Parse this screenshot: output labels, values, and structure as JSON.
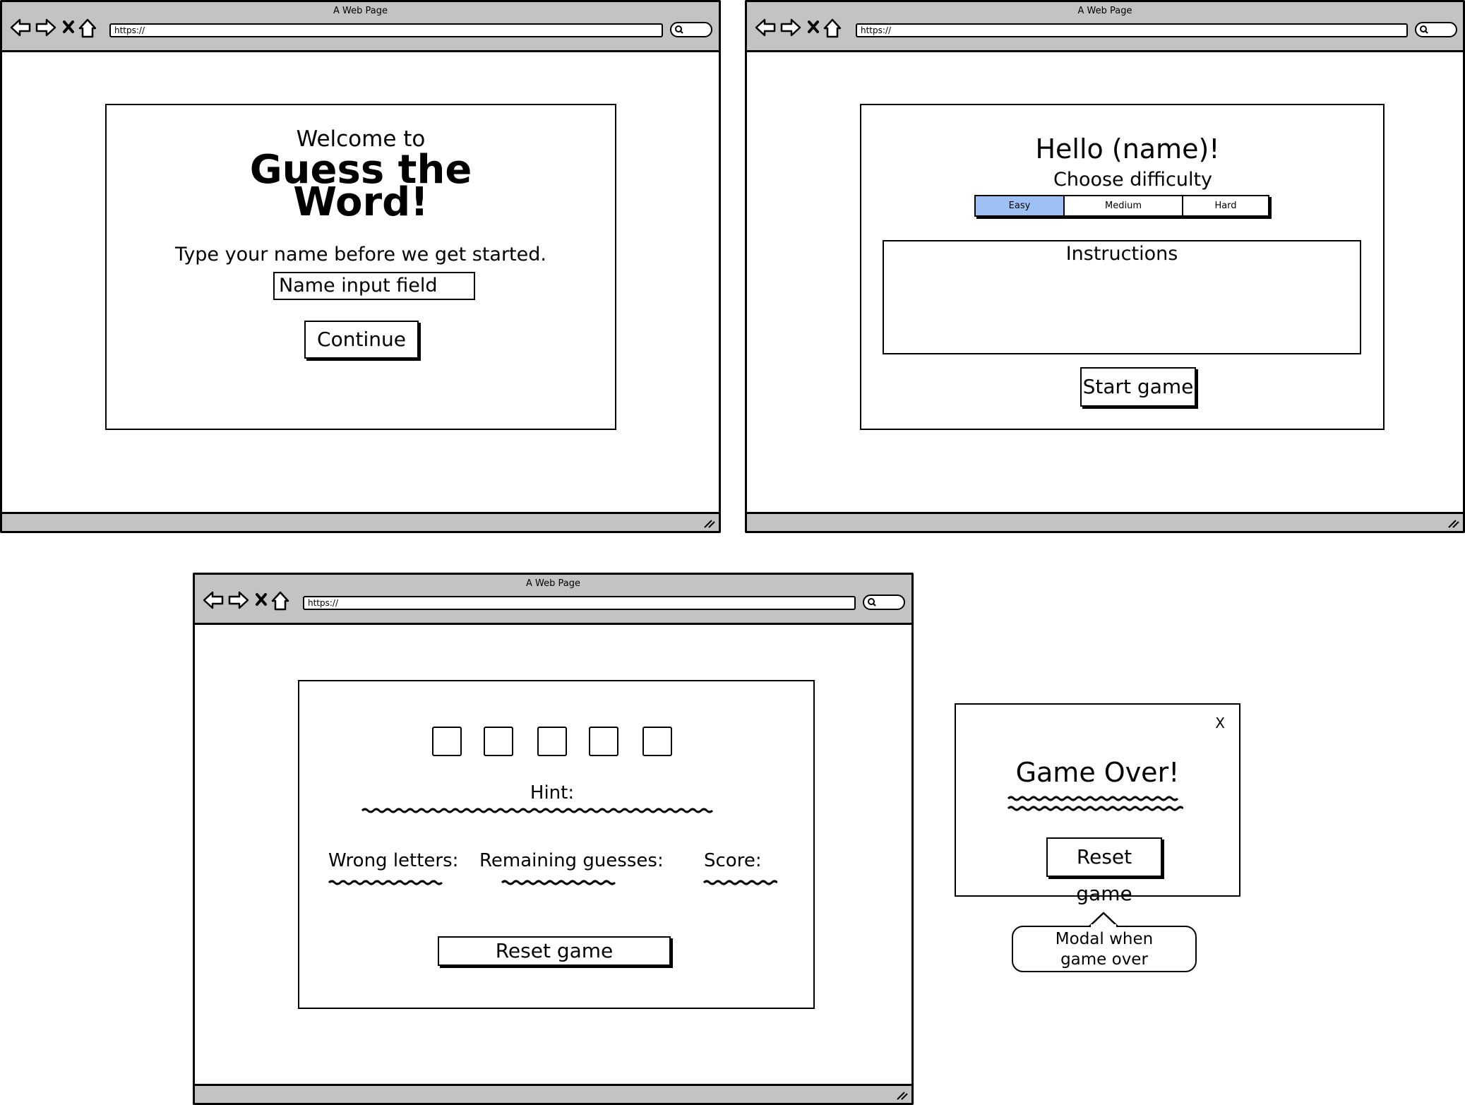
{
  "browser": {
    "window_title": "A Web Page",
    "url": "https://"
  },
  "screen1": {
    "welcome_line": "Welcome to",
    "title_line1": "Guess the",
    "title_line2": "Word!",
    "prompt": "Type your name before we get started.",
    "name_input_value": "Name input field",
    "continue_label": "Continue"
  },
  "screen2": {
    "greeting": "Hello (name)!",
    "choose_label": "Choose difficulty",
    "difficulty_options": [
      "Easy",
      "Medium",
      "Hard"
    ],
    "selected_difficulty": "Easy",
    "instructions_title": "Instructions",
    "start_label": "Start game"
  },
  "screen3": {
    "letter_boxes": 5,
    "hint_label": "Hint:",
    "wrong_letters_label": "Wrong letters:",
    "remaining_label": "Remaining guesses:",
    "score_label": "Score:",
    "reset_label": "Reset game"
  },
  "modal": {
    "close_label": "X",
    "title": "Game Over!",
    "reset_label": "Reset game",
    "callout": "Modal when game over"
  },
  "colors": {
    "chrome_gray": "#c3c3c3",
    "selected_tab": "#9dc0f5"
  },
  "icons": [
    "back-arrow-icon",
    "forward-arrow-icon",
    "close-icon",
    "home-icon",
    "search-icon",
    "resize-grip-icon"
  ]
}
